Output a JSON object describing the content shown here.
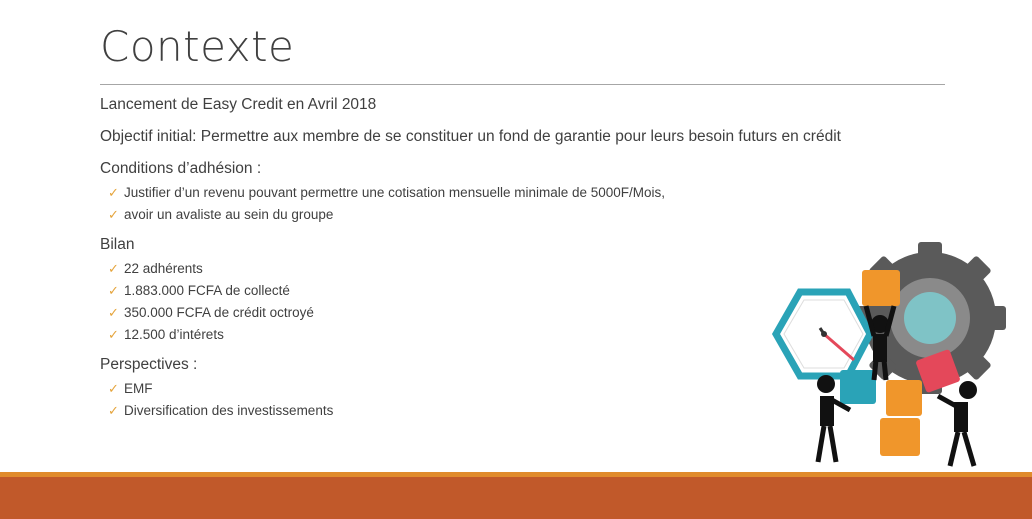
{
  "slide": {
    "title": "Contexte",
    "line1": "Lancement de Easy Credit en Avril 2018",
    "line2": "Objectif initial: Permettre aux membre de se constituer un fond de garantie pour leurs besoin futurs en crédit",
    "conditions": {
      "heading": "Conditions d’adhésion :",
      "items": [
        "Justifier d’un revenu pouvant permettre une cotisation mensuelle minimale de 5000F/Mois,",
        "avoir un avaliste au sein du groupe"
      ]
    },
    "bilan": {
      "heading": "Bilan",
      "items": [
        "22 adhérents",
        "1.883.000 FCFA de collecté",
        "350.000 FCFA de crédit octroyé",
        "12.500 d’intérets"
      ]
    },
    "perspectives": {
      "heading": "Perspectives :",
      "items": [
        "EMF",
        "Diversification des investissements"
      ]
    },
    "bullet_icon": "checkmark-icon",
    "colors": {
      "accent_orange": "#e08b2c",
      "footer_rust": "#c1592a",
      "check": "#e5a43b",
      "gear": "#5a5a5a",
      "teal": "#2aa3b7",
      "box_orange": "#f0962b",
      "box_red": "#e4485a"
    }
  }
}
